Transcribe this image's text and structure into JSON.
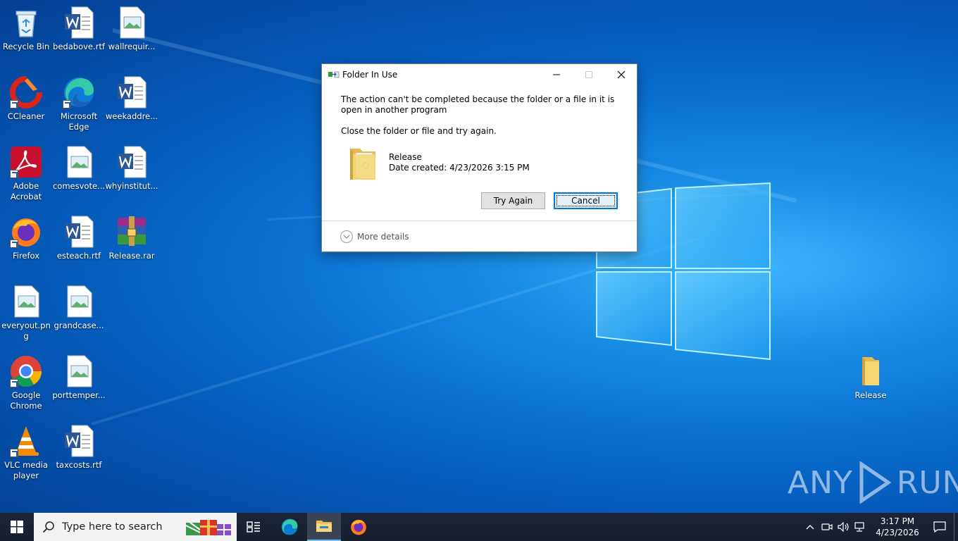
{
  "desktop": {
    "icons": [
      {
        "label": "Recycle Bin"
      },
      {
        "label": "bedabove.rtf"
      },
      {
        "label": "wallrequir..."
      },
      {
        "label": "CCleaner"
      },
      {
        "label": "Microsoft Edge"
      },
      {
        "label": "weekaddre..."
      },
      {
        "label": "Adobe Acrobat"
      },
      {
        "label": "comesvote..."
      },
      {
        "label": "whyinstitut..."
      },
      {
        "label": "Firefox"
      },
      {
        "label": "esteach.rtf"
      },
      {
        "label": "Release.rar"
      },
      {
        "label": "everyout.png"
      },
      {
        "label": "grandcase..."
      },
      {
        "label": "Google Chrome"
      },
      {
        "label": "porttemper..."
      },
      {
        "label": "VLC media player"
      },
      {
        "label": "taxcosts.rtf"
      },
      {
        "label": "Release"
      }
    ]
  },
  "watermark": {
    "left": "ANY",
    "right": "RUN"
  },
  "dialog": {
    "title": "Folder In Use",
    "message1": "The action can't be completed because the folder or a file in it is open in another program",
    "message2": "Close the folder or file and try again.",
    "file_name": "Release",
    "file_date": "Date created: 4/23/2026 3:15 PM",
    "try_again": "Try Again",
    "cancel": "Cancel",
    "more_details": "More details"
  },
  "taskbar": {
    "search_placeholder": "Type here to search",
    "time": "3:17 PM",
    "date": "4/23/2026"
  },
  "colors": {
    "accent": "#0078d7",
    "taskbar": "#1b2436",
    "desktop": "#0a6fd0"
  }
}
